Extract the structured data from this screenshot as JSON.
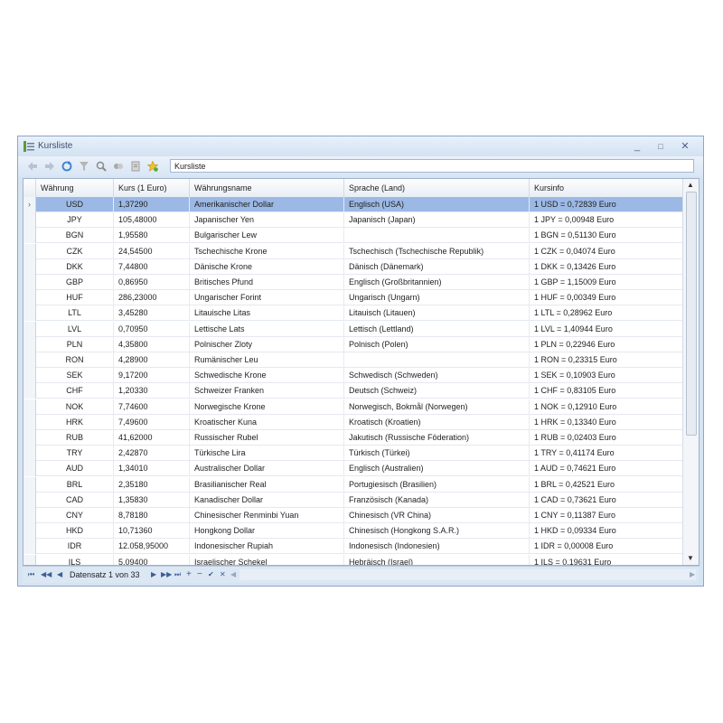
{
  "window": {
    "title": "Kursliste",
    "minimize": "_",
    "maximize": "□",
    "close": "✕"
  },
  "toolbar": {
    "search_value": "Kursliste"
  },
  "columns": [
    "Währung",
    "Kurs (1 Euro)",
    "Währungsname",
    "Sprache (Land)",
    "Kursinfo"
  ],
  "rows": [
    [
      "USD",
      "1,37290",
      "Amerikanischer Dollar",
      "Englisch (USA)",
      "1 USD = 0,72839 Euro"
    ],
    [
      "JPY",
      "105,48000",
      "Japanischer Yen",
      "Japanisch (Japan)",
      "1 JPY = 0,00948 Euro"
    ],
    [
      "BGN",
      "1,95580",
      "Bulgarischer Lew",
      "",
      "1 BGN = 0,51130 Euro"
    ],
    [
      "CZK",
      "24,54500",
      "Tschechische Krone",
      "Tschechisch (Tschechische Republik)",
      "1 CZK = 0,04074 Euro"
    ],
    [
      "DKK",
      "7,44800",
      "Dänische Krone",
      "Dänisch (Dänemark)",
      "1 DKK = 0,13426 Euro"
    ],
    [
      "GBP",
      "0,86950",
      "Britisches Pfund",
      "Englisch (Großbritannien)",
      "1 GBP = 1,15009 Euro"
    ],
    [
      "HUF",
      "286,23000",
      "Ungarischer Forint",
      "Ungarisch (Ungarn)",
      "1 HUF = 0,00349 Euro"
    ],
    [
      "LTL",
      "3,45280",
      "Litauische Litas",
      "Litauisch (Litauen)",
      "1 LTL = 0,28962 Euro"
    ],
    [
      "LVL",
      "0,70950",
      "Lettische Lats",
      "Lettisch (Lettland)",
      "1 LVL = 1,40944 Euro"
    ],
    [
      "PLN",
      "4,35800",
      "Polnischer Zloty",
      "Polnisch (Polen)",
      "1 PLN = 0,22946 Euro"
    ],
    [
      "RON",
      "4,28900",
      "Rumänischer Leu",
      "",
      "1 RON = 0,23315 Euro"
    ],
    [
      "SEK",
      "9,17200",
      "Schwedische Krone",
      "Schwedisch (Schweden)",
      "1 SEK = 0,10903 Euro"
    ],
    [
      "CHF",
      "1,20330",
      "Schweizer Franken",
      "Deutsch (Schweiz)",
      "1 CHF = 0,83105 Euro"
    ],
    [
      "NOK",
      "7,74600",
      "Norwegische Krone",
      "Norwegisch, Bokmål (Norwegen)",
      "1 NOK = 0,12910 Euro"
    ],
    [
      "HRK",
      "7,49600",
      "Kroatischer Kuna",
      "Kroatisch (Kroatien)",
      "1 HRK = 0,13340 Euro"
    ],
    [
      "RUB",
      "41,62000",
      "Russischer Rubel",
      "Jakutisch (Russische Föderation)",
      "1 RUB = 0,02403 Euro"
    ],
    [
      "TRY",
      "2,42870",
      "Türkische Lira",
      "Türkisch (Türkei)",
      "1 TRY = 0,41174 Euro"
    ],
    [
      "AUD",
      "1,34010",
      "Australischer Dollar",
      "Englisch (Australien)",
      "1 AUD = 0,74621 Euro"
    ],
    [
      "BRL",
      "2,35180",
      "Brasilianischer Real",
      "Portugiesisch (Brasilien)",
      "1 BRL = 0,42521 Euro"
    ],
    [
      "CAD",
      "1,35830",
      "Kanadischer Dollar",
      "Französisch (Kanada)",
      "1 CAD = 0,73621 Euro"
    ],
    [
      "CNY",
      "8,78180",
      "Chinesischer Renminbi Yuan",
      "Chinesisch (VR China)",
      "1 CNY = 0,11387 Euro"
    ],
    [
      "HKD",
      "10,71360",
      "Hongkong Dollar",
      "Chinesisch (Hongkong S.A.R.)",
      "1 HKD = 0,09334 Euro"
    ],
    [
      "IDR",
      "12.058,95000",
      "Indonesischer Rupiah",
      "Indonesisch (Indonesien)",
      "1 IDR = 0,00008 Euro"
    ],
    [
      "ILS",
      "5,09400",
      "Israelischer Schekel",
      "Hebräisch (Israel)",
      "1 ILS = 0,19631 Euro"
    ]
  ],
  "selected_row": 0,
  "navigator": {
    "label": "Datensatz 1 von 33"
  },
  "colors": {
    "selection": "#9cb9e6",
    "frame": "#d6e3f2",
    "accent": "#3e5f94"
  }
}
